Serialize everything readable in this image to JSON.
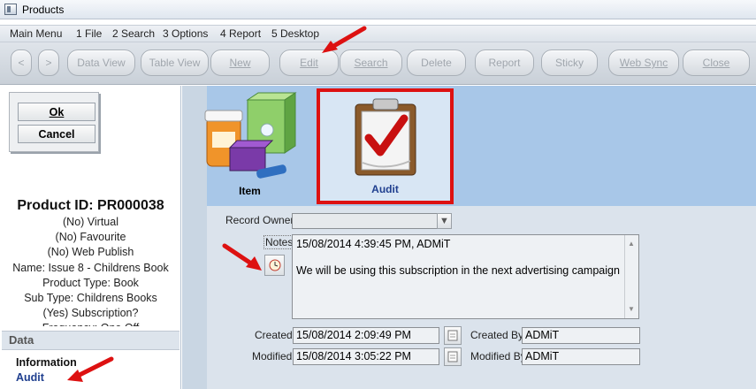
{
  "window": {
    "title": "Products"
  },
  "menu": [
    "Main Menu",
    "1 File",
    "2 Search",
    "3 Options",
    "4 Report",
    "5 Desktop"
  ],
  "toolbar": {
    "back": "<",
    "forward": ">",
    "data_view": "Data View",
    "table_view": "Table View",
    "new": "New",
    "edit": "Edit",
    "search": "Search",
    "delete": "Delete",
    "report": "Report",
    "sticky": "Sticky",
    "web_sync": "Web Sync",
    "close": "Close"
  },
  "left": {
    "ok": "Ok",
    "cancel": "Cancel",
    "product_id": "Product ID: PR000038",
    "lines": [
      "(No) Virtual",
      "(No) Favourite",
      "(No) Web Publish",
      "Name: Issue 8 - Childrens Book",
      "Product Type: Book",
      "Sub Type: Childrens Books",
      "(Yes) Subscription?",
      "Frequency: One Off"
    ],
    "data_header": "Data",
    "links": {
      "information": "Information",
      "audit": "Audit"
    }
  },
  "tiles": {
    "item": "Item",
    "audit": "Audit"
  },
  "form": {
    "record_owner_label": "Record Owner",
    "record_owner_value": "",
    "notes_label": "Notes",
    "notes_line1": "15/08/2014 4:39:45 PM, ADMiT",
    "notes_line2": "We will be using this subscription in the next advertising campaign",
    "created_label": "Created",
    "created_value": "15/08/2014 2:09:49 PM",
    "created_by_label": "Created By",
    "created_by_value": "ADMiT",
    "modified_label": "Modified",
    "modified_value": "15/08/2014 3:05:22 PM",
    "modified_by_label": "Modified By",
    "modified_by_value": "ADMiT"
  },
  "colors": {
    "accent_red": "#dd1111",
    "banner_blue": "#a8c7e8",
    "link_blue": "#1f3f8f"
  }
}
